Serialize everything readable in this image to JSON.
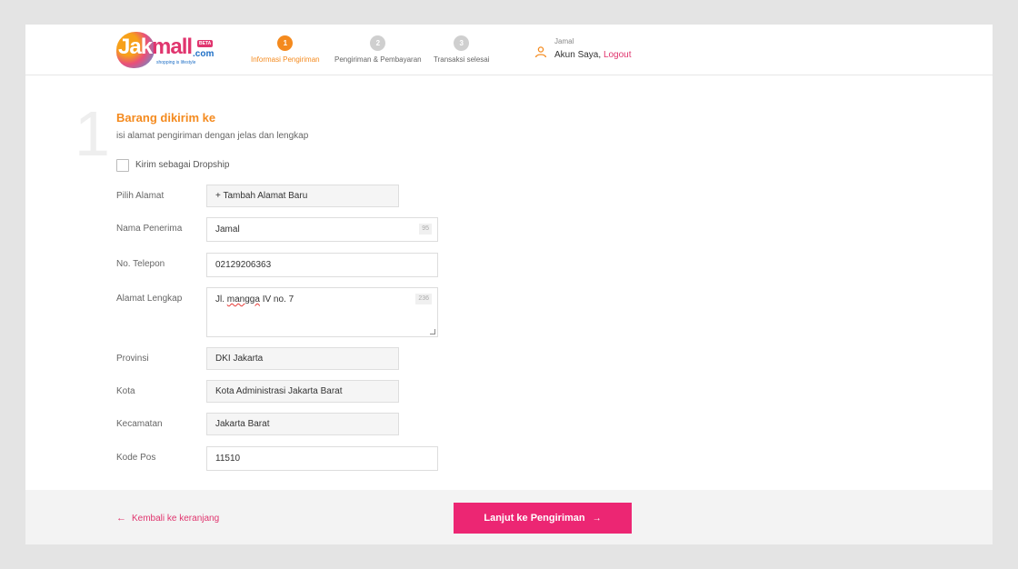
{
  "brand": {
    "logo_part1": "Jak",
    "logo_part2": "mall",
    "logo_domain": ".com",
    "logo_badge": "BETA",
    "tagline": "shopping is lifestyle"
  },
  "steps": [
    {
      "num": "1",
      "label": "Informasi Pengiriman",
      "active": true
    },
    {
      "num": "2",
      "label": "Pengiriman & Pembayaran",
      "active": false
    },
    {
      "num": "3",
      "label": "Transaksi selesai",
      "active": false
    }
  ],
  "account": {
    "greeting": "Jamal",
    "my_account": "Akun Saya,",
    "logout": "Logout"
  },
  "section": {
    "number": "1",
    "title": "Barang dikirim ke",
    "subtitle": "isi alamat pengiriman dengan jelas dan lengkap"
  },
  "dropship": {
    "label": "Kirim sebagai Dropship",
    "checked": false
  },
  "form": {
    "pilih_alamat": {
      "label": "Pilih Alamat",
      "value": "+ Tambah Alamat Baru"
    },
    "nama_penerima": {
      "label": "Nama Penerima",
      "value": "Jamal",
      "counter": "95"
    },
    "no_telepon": {
      "label": "No. Telepon",
      "value": "02129206363"
    },
    "alamat_lengkap": {
      "label": "Alamat Lengkap",
      "value_pre": "Jl. ",
      "value_misspelled": "mangga",
      "value_post": " IV no. 7",
      "counter": "236"
    },
    "provinsi": {
      "label": "Provinsi",
      "value": "DKI Jakarta"
    },
    "kota": {
      "label": "Kota",
      "value": "Kota Administrasi Jakarta Barat"
    },
    "kecamatan": {
      "label": "Kecamatan",
      "value": "Jakarta Barat"
    },
    "kode_pos": {
      "label": "Kode Pos",
      "value": "11510"
    }
  },
  "footer": {
    "back_label": "Kembali ke keranjang",
    "next_label": "Lanjut ke Pengiriman",
    "back_arrow": "←",
    "next_arrow": "→"
  },
  "colors": {
    "accent_orange": "#f48a1e",
    "accent_pink": "#ec2673"
  },
  "icons": {
    "user": "user-icon",
    "back": "arrow-left-icon",
    "next": "arrow-right-icon"
  }
}
